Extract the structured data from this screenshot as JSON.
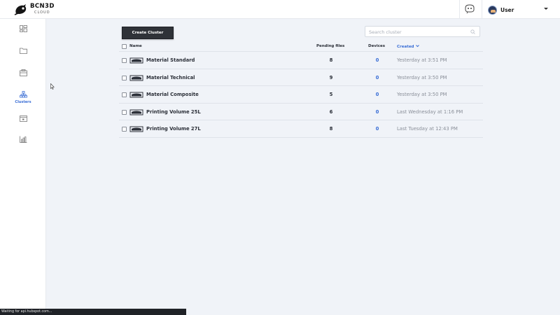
{
  "header": {
    "logo_title": "BCN3D",
    "logo_subtitle": "CLOUD",
    "user_name": "User"
  },
  "sidebar": {
    "items": [
      {
        "icon": "dashboard-icon",
        "label": ""
      },
      {
        "icon": "folder-icon",
        "label": ""
      },
      {
        "icon": "printer-icon",
        "label": ""
      },
      {
        "icon": "clusters-icon",
        "label": "Clusters"
      },
      {
        "icon": "calendar-icon",
        "label": ""
      },
      {
        "icon": "stats-icon",
        "label": ""
      }
    ]
  },
  "toolbar": {
    "create_label": "Create Cluster",
    "search_placeholder": "Search cluster"
  },
  "table": {
    "columns": {
      "name": "Name",
      "pending": "Pending files",
      "devices": "Devices",
      "created": "Created"
    },
    "rows": [
      {
        "name": "Material Standard",
        "pending": "8",
        "devices": "0",
        "created": "Yesterday at 3:51 PM"
      },
      {
        "name": "Material Technical",
        "pending": "9",
        "devices": "0",
        "created": "Yesterday at 3:50 PM"
      },
      {
        "name": "Material Composite",
        "pending": "5",
        "devices": "0",
        "created": "Yesterday at 3:50 PM"
      },
      {
        "name": "Printing Volume 25L",
        "pending": "6",
        "devices": "0",
        "created": "Last Wednesday at 1:16 PM"
      },
      {
        "name": "Printing Volume 27L",
        "pending": "8",
        "devices": "0",
        "created": "Last Tuesday at 12:43 PM"
      }
    ]
  },
  "status_bar": "Waiting for api.hubspot.com...",
  "colors": {
    "accent": "#3b6fd6",
    "button_dark": "#2f3238",
    "background": "#f0f3f8"
  }
}
